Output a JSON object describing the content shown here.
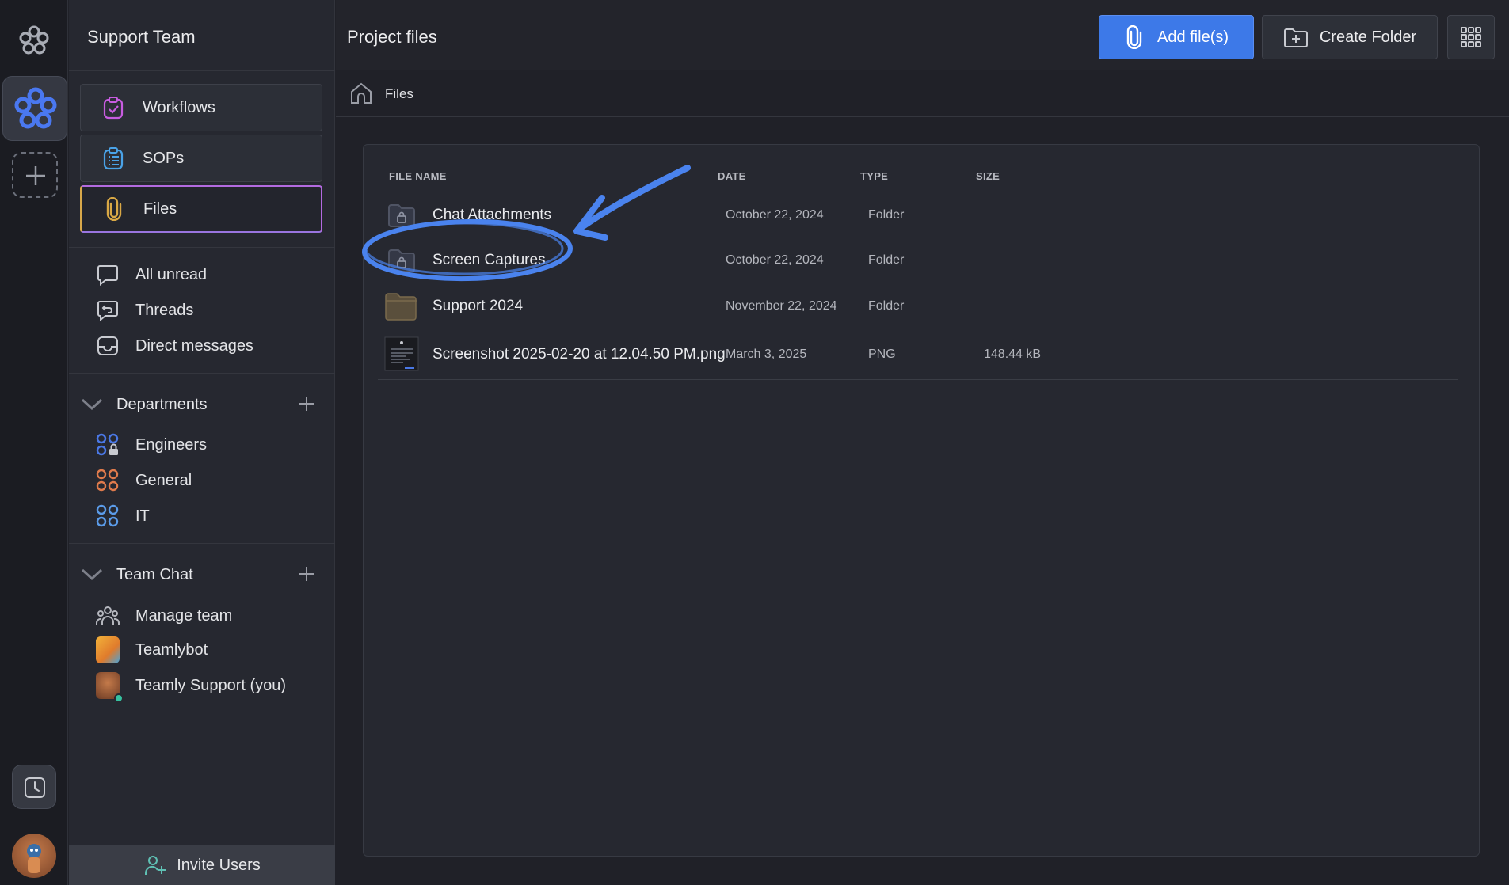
{
  "rail": {
    "logo_icon": "flower-logo-icon",
    "active_workspace_icon": "flower-logo-icon",
    "add_workspace_icon": "plus-icon",
    "history_icon": "clock-icon"
  },
  "sidebar": {
    "team_name": "Support Team",
    "nav_cards": [
      {
        "label": "Workflows",
        "icon": "clipboard-check-icon"
      },
      {
        "label": "SOPs",
        "icon": "clipboard-list-icon"
      },
      {
        "label": "Files",
        "icon": "paperclip-icon"
      }
    ],
    "quick_items": [
      {
        "label": "All unread",
        "icon": "chat-bubble-icon"
      },
      {
        "label": "Threads",
        "icon": "threads-icon"
      },
      {
        "label": "Direct messages",
        "icon": "inbox-icon"
      }
    ],
    "departments": {
      "title": "Departments",
      "items": [
        {
          "label": "Engineers",
          "icon": "channel-locked-icon",
          "color": "#4a78e6"
        },
        {
          "label": "General",
          "icon": "channel-icon",
          "color": "#e07b4c"
        },
        {
          "label": "IT",
          "icon": "channel-icon",
          "color": "#5b9be8"
        }
      ]
    },
    "team_chat": {
      "title": "Team Chat",
      "items": [
        {
          "label": "Manage team",
          "icon": "team-icon"
        },
        {
          "label": "Teamlybot",
          "icon": "bot-avatar"
        },
        {
          "label": "Teamly Support (you)",
          "icon": "user-avatar"
        }
      ]
    },
    "invite_label": "Invite Users"
  },
  "main": {
    "title": "Project files",
    "add_files_label": "Add file(s)",
    "create_folder_label": "Create Folder",
    "breadcrumb": "Files",
    "columns": [
      "FILE NAME",
      "DATE",
      "TYPE",
      "SIZE"
    ],
    "rows": [
      {
        "name": "Chat Attachments",
        "date": "October 22, 2024",
        "type": "Folder",
        "size": "",
        "icon": "locked-folder-icon"
      },
      {
        "name": "Screen Captures",
        "date": "October 22, 2024",
        "type": "Folder",
        "size": "",
        "icon": "locked-folder-icon"
      },
      {
        "name": "Support 2024",
        "date": "November 22, 2024",
        "type": "Folder",
        "size": "",
        "icon": "folder-icon"
      },
      {
        "name": "Screenshot 2025-02-20 at 12.04.50 PM.png",
        "date": "March 3, 2025",
        "type": "PNG",
        "size": "148.44 kB",
        "icon": "image-thumbnail"
      }
    ]
  },
  "colors": {
    "accent_blue": "#3d79e8",
    "annotation_blue": "#4a83ee",
    "files_active_border": "#b36ae0"
  }
}
